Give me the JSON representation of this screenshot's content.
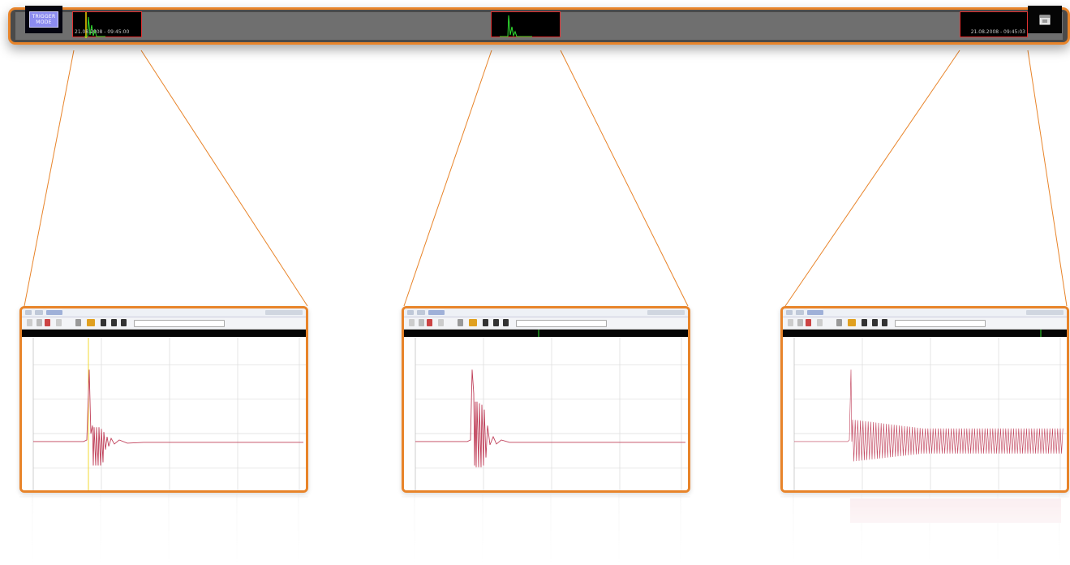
{
  "colors": {
    "accent": "#e8842a",
    "bar_bg": "#4a4a4a",
    "trace": "#c0405a",
    "trigger": "#f0d000",
    "spike": "#30e030",
    "window_border": "#e03030"
  },
  "timeline": {
    "trigger_button_label": "TRIGGER\nMODE",
    "trigger_icon": "trigger-mode-icon",
    "nav_icon": "calendar-icon",
    "window_left_timestamp": "21.08.2008 - 09:45:00",
    "window_right_timestamp": "21.08.2008 - 09:45:03"
  },
  "thumbnails": [
    {
      "id": "left",
      "shape": "decay"
    },
    {
      "id": "center",
      "shape": "decay-narrow"
    },
    {
      "id": "right",
      "shape": "oscillation"
    }
  ]
}
